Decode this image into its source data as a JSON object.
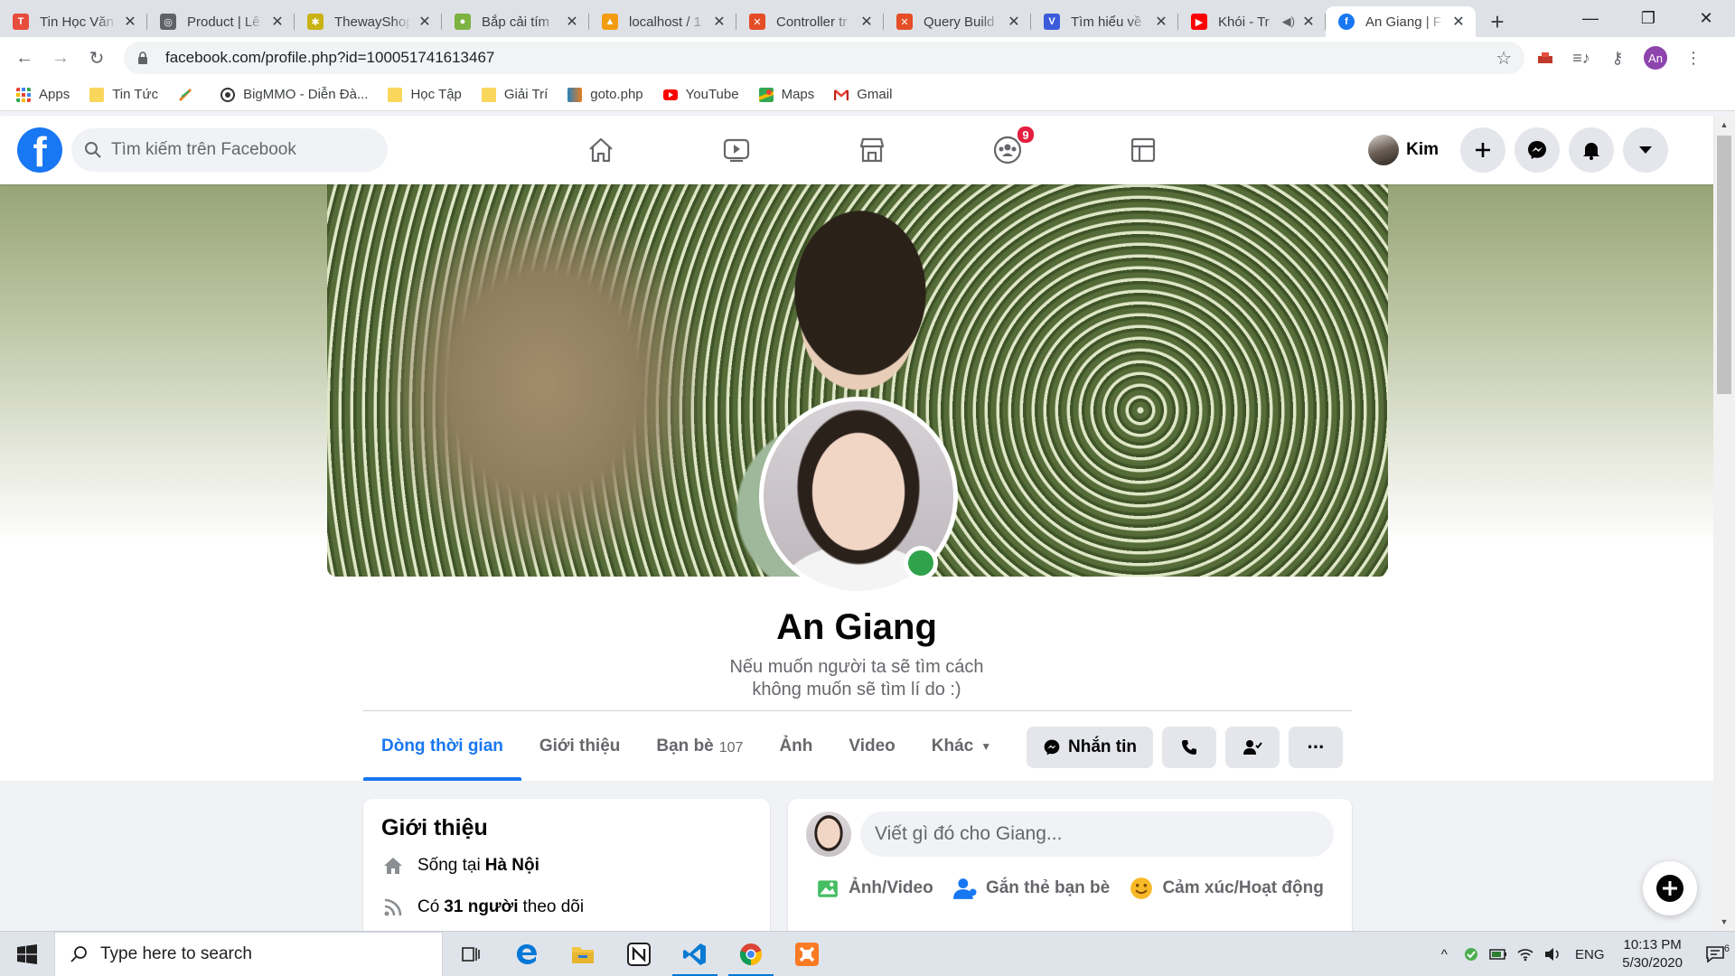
{
  "browser": {
    "tabs": [
      {
        "title": "Tin Học Văn",
        "fav_color": "#e74c3c",
        "fav_text": "T"
      },
      {
        "title": "Product | Lê",
        "fav_color": "#5f6368",
        "fav_text": "◎"
      },
      {
        "title": "ThewayShop",
        "fav_color": "#f0c419",
        "fav_text": "✱"
      },
      {
        "title": "Bắp cải tím",
        "fav_color": "#7cb342",
        "fav_text": "●"
      },
      {
        "title": "localhost / 1",
        "fav_color": "#f39c12",
        "fav_text": "▲"
      },
      {
        "title": "Controller tr",
        "fav_color": "#e44d26",
        "fav_text": "✕"
      },
      {
        "title": "Query Build",
        "fav_color": "#e44d26",
        "fav_text": "✕"
      },
      {
        "title": "Tìm hiểu về",
        "fav_color": "#3b5bdb",
        "fav_text": "V"
      },
      {
        "title": "Khói - Tr",
        "fav_color": "#ff0000",
        "fav_text": "▶"
      },
      {
        "title": "An Giang | F",
        "fav_color": "#1877f2",
        "fav_text": "f"
      }
    ],
    "url": "facebook.com/profile.php?id=100051741613467",
    "profile_initials": "An"
  },
  "bookmarks": [
    {
      "label": "Apps",
      "kind": "apps"
    },
    {
      "label": "Tin Tức",
      "kind": "folder"
    },
    {
      "label": "",
      "kind": "leaf"
    },
    {
      "label": "BigMMO - Diễn Đà...",
      "kind": "site"
    },
    {
      "label": "Học Tập",
      "kind": "folder"
    },
    {
      "label": "Giải Trí",
      "kind": "folder"
    },
    {
      "label": "goto.php",
      "kind": "site2"
    },
    {
      "label": "YouTube",
      "kind": "youtube"
    },
    {
      "label": "Maps",
      "kind": "maps"
    },
    {
      "label": "Gmail",
      "kind": "gmail"
    }
  ],
  "facebook": {
    "search_placeholder": "Tìm kiếm trên Facebook",
    "groups_badge": "9",
    "user_name": "Kim",
    "accent": "#1877f2"
  },
  "profile": {
    "name": "An Giang",
    "bio_line1": "Nếu muốn người ta sẽ tìm cách",
    "bio_line2": "không muốn sẽ tìm lí do :)",
    "tabs": {
      "timeline": "Dòng thời gian",
      "about": "Giới thiệu",
      "friends": "Bạn bè",
      "friends_count": "107",
      "photos": "Ảnh",
      "videos": "Video",
      "more": "Khác"
    },
    "message_button": "Nhắn tin",
    "more_dots": "···"
  },
  "intro": {
    "title": "Giới thiệu",
    "lives_prefix": "Sống tại",
    "lives_city": "Hà Nội",
    "followers_prefix": "Có",
    "followers_count": "31 người",
    "followers_suffix": "theo dõi"
  },
  "composer": {
    "placeholder": "Viết gì đó cho Giang...",
    "photo_video": "Ảnh/Video",
    "tag_friends": "Gắn thẻ bạn bè",
    "feeling": "Cảm xúc/Hoạt động"
  },
  "taskbar": {
    "search_placeholder": "Type here to search",
    "language": "ENG",
    "time": "10:13 PM",
    "date": "5/30/2020",
    "notif_count": "6"
  }
}
